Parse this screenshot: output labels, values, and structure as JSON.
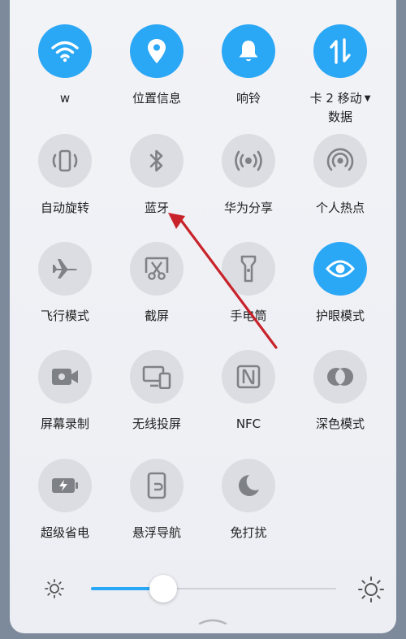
{
  "tiles": [
    {
      "label": "w",
      "icon": "wifi-icon",
      "active": true
    },
    {
      "label": "位置信息",
      "icon": "location-icon",
      "active": true
    },
    {
      "label": "响铃",
      "icon": "bell-icon",
      "active": true
    },
    {
      "label": "卡 2 移动",
      "label2": "数据",
      "icon": "mobile-data-icon",
      "active": true
    },
    {
      "label": "自动旋转",
      "icon": "auto-rotate-icon",
      "active": false
    },
    {
      "label": "蓝牙",
      "icon": "bluetooth-icon",
      "active": false
    },
    {
      "label": "华为分享",
      "icon": "huawei-share-icon",
      "active": false
    },
    {
      "label": "个人热点",
      "icon": "hotspot-icon",
      "active": false
    },
    {
      "label": "飞行模式",
      "icon": "airplane-icon",
      "active": false
    },
    {
      "label": "截屏",
      "icon": "screenshot-icon",
      "active": false
    },
    {
      "label": "手电筒",
      "icon": "flashlight-icon",
      "active": false
    },
    {
      "label": "护眼模式",
      "icon": "eye-comfort-icon",
      "active": true
    },
    {
      "label": "屏幕录制",
      "icon": "screen-record-icon",
      "active": false
    },
    {
      "label": "无线投屏",
      "icon": "wireless-projection-icon",
      "active": false
    },
    {
      "label": "NFC",
      "icon": "nfc-icon",
      "active": false
    },
    {
      "label": "深色模式",
      "icon": "dark-mode-icon",
      "active": false
    },
    {
      "label": "超级省电",
      "icon": "battery-saver-icon",
      "active": false
    },
    {
      "label": "悬浮导航",
      "icon": "floating-nav-icon",
      "active": false
    },
    {
      "label": "免打扰",
      "icon": "do-not-disturb-icon",
      "active": false
    }
  ],
  "brightness": {
    "level": 0.3
  },
  "colors": {
    "accent": "#2aa7f5",
    "inactive": "#dcdde2",
    "annotation_arrow": "#c8232a"
  }
}
